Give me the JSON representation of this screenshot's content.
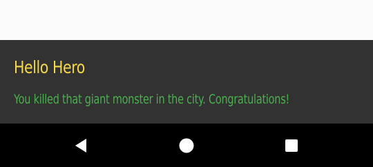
{
  "snackbar": {
    "title": "Hello Hero",
    "message": "You killed that giant monster in the city. Congratulations!"
  },
  "navbar": {
    "back_icon": "back-triangle-icon",
    "home_icon": "home-circle-icon",
    "recents_icon": "recents-square-icon"
  },
  "colors": {
    "title": "#f5d84a",
    "message": "#4caf50",
    "snackbar_bg": "#323232",
    "navbar_bg": "#000000",
    "nav_icon": "#ffffff"
  }
}
